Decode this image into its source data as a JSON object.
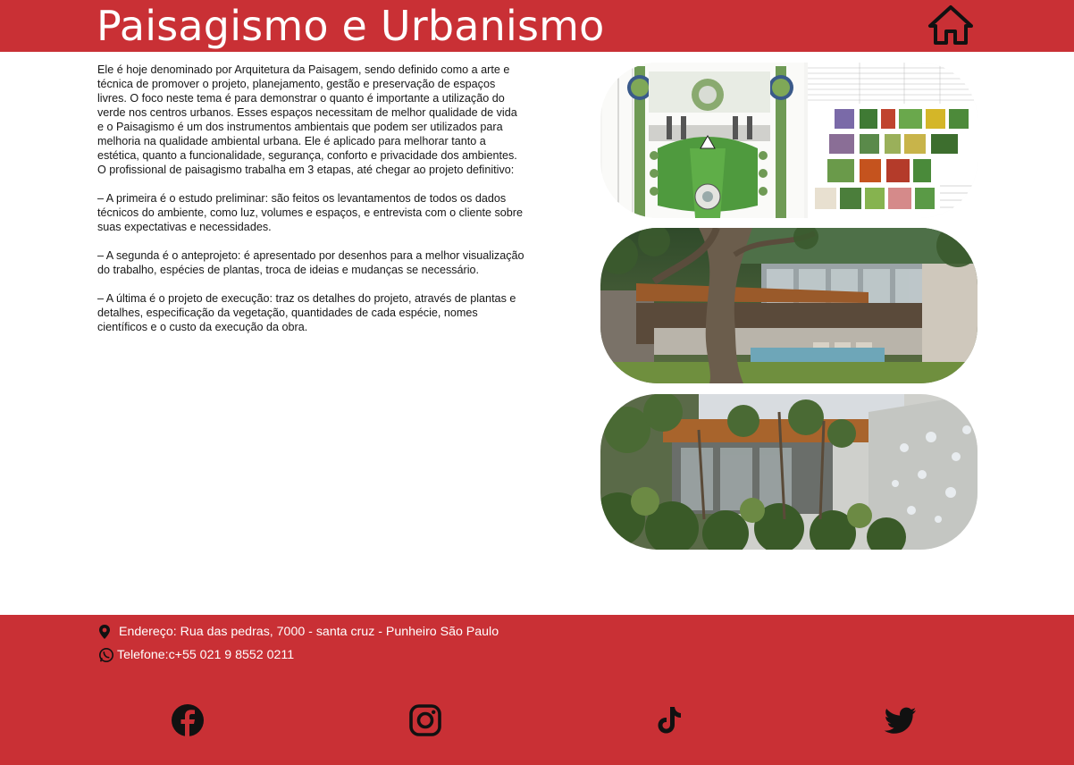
{
  "header": {
    "title": "Paisagismo e Urbanismo",
    "home_icon": "home-icon"
  },
  "main": {
    "paragraphs": [
      "Ele é hoje denominado por Arquitetura da Paisagem, sendo definido como a arte e técnica de promover o projeto, planejamento, gestão e preservação de espaços livres. O foco neste tema é para demonstrar o quanto é importante a utilização do verde nos centros urbanos. Esses espaços necessitam de melhor qualidade de vida e o Paisagismo é um dos instrumentos ambientais que podem ser utilizados para melhoria na qualidade ambiental urbana. Ele é aplicado para melhorar tanto a estética, quanto a funcionalidade, segurança, conforto e privacidade dos ambientes.\nO profissional de paisagismo trabalha em 3 etapas, até chegar ao projeto definitivo:",
      "– A primeira é o estudo preliminar: são feitos os levantamentos de todos os dados técnicos do ambiente, como luz, volumes e espaços, e entrevista com o cliente sobre suas expectativas e necessidades.",
      "– A segunda é o anteprojeto: é apresentado por desenhos para a melhor visualização do trabalho, espécies de plantas, troca de ideias e mudanças se necessário.",
      "– A última é o projeto de execução: traz os detalhes do projeto, através de plantas e detalhes, especificação da vegetação, quantidades de cada espécie, nomes científicos e o custo da execução da obra."
    ]
  },
  "footer": {
    "address": "Endereço: Rua das pedras, 7000 - santa cruz - Punheiro São Paulo",
    "phone": "Telefone:c+55 021 9 8552 0211",
    "social": [
      "facebook-icon",
      "instagram-icon",
      "tiktok-icon",
      "twitter-icon"
    ]
  },
  "colors": {
    "brand_red": "#c93035",
    "text_white": "#ffffff"
  }
}
